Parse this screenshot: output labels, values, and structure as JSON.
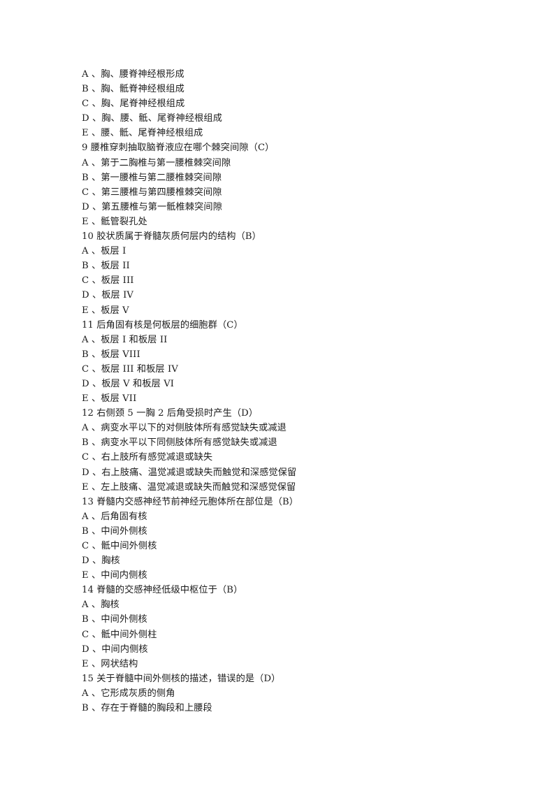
{
  "document": {
    "page_background": "#ffffff",
    "text_color": "#1c1c1c",
    "lines": [
      {
        "id": "l01",
        "kind": "option",
        "text": "A 、胸、腰脊神经根形成"
      },
      {
        "id": "l02",
        "kind": "option",
        "text": "B 、胸、骶脊神经根组成"
      },
      {
        "id": "l03",
        "kind": "option",
        "text": "C 、胸、尾脊神经根组成"
      },
      {
        "id": "l04",
        "kind": "option",
        "text": "D 、胸、腰、骶、尾脊神经根组成"
      },
      {
        "id": "l05",
        "kind": "option",
        "text": "E 、腰、骶、尾脊神经根组成"
      },
      {
        "id": "l06",
        "kind": "stem",
        "text": "9 腰椎穿刺抽取脑脊液应在哪个棘突间隙（C）"
      },
      {
        "id": "l07",
        "kind": "option",
        "text": "A 、第于二胸椎与第一腰椎棘突间隙"
      },
      {
        "id": "l08",
        "kind": "option",
        "text": "B 、第一腰椎与第二腰椎棘突间隙"
      },
      {
        "id": "l09",
        "kind": "option",
        "text": "C 、第三腰椎与第四腰椎棘突间隙"
      },
      {
        "id": "l10",
        "kind": "option",
        "text": "D 、第五腰椎与第一骶椎棘突间隙"
      },
      {
        "id": "l11",
        "kind": "option",
        "text": "E 、骶管裂孔处"
      },
      {
        "id": "l12",
        "kind": "stem",
        "text": "10 胶状质属于脊髓灰质何层内的结构（B）"
      },
      {
        "id": "l13",
        "kind": "option",
        "text": "A 、板层 I"
      },
      {
        "id": "l14",
        "kind": "option",
        "text": "B 、板层 II"
      },
      {
        "id": "l15",
        "kind": "option",
        "text": "C 、板层 III"
      },
      {
        "id": "l16",
        "kind": "option",
        "text": "D 、板层 IV"
      },
      {
        "id": "l17",
        "kind": "option",
        "text": "E 、板层 V"
      },
      {
        "id": "l18",
        "kind": "stem",
        "text": "11 后角固有核是何板层的细胞群（C）"
      },
      {
        "id": "l19",
        "kind": "option",
        "text": "A 、板层 I 和板层 II"
      },
      {
        "id": "l20",
        "kind": "option",
        "text": "B 、板层 VIII"
      },
      {
        "id": "l21",
        "kind": "option",
        "text": "C 、板层 III 和板层 IV"
      },
      {
        "id": "l22",
        "kind": "option",
        "text": "D 、板层 V 和板层 VI"
      },
      {
        "id": "l23",
        "kind": "option",
        "text": "E 、板层 VII"
      },
      {
        "id": "l24",
        "kind": "stem",
        "text": "12 右侧颈 5 一胸 2 后角受损时产生（D）"
      },
      {
        "id": "l25",
        "kind": "option",
        "text": "A 、病变水平以下的对侧肢体所有感觉缺失或减退"
      },
      {
        "id": "l26",
        "kind": "option",
        "text": "B 、病变水平以下同侧肢体所有感觉缺失或减退"
      },
      {
        "id": "l27",
        "kind": "option",
        "text": "C 、右上肢所有感觉减退或缺失"
      },
      {
        "id": "l28",
        "kind": "option",
        "text": "D 、右上肢痛、温觉减退或缺失而触觉和深感觉保留"
      },
      {
        "id": "l29",
        "kind": "option",
        "text": "E 、左上肢痛、温觉减退或缺失而触觉和深感觉保留"
      },
      {
        "id": "l30",
        "kind": "stem",
        "text": "13 脊髓内交感神经节前神经元胞体所在部位是（B）"
      },
      {
        "id": "l31",
        "kind": "option",
        "text": "A 、后角固有核"
      },
      {
        "id": "l32",
        "kind": "option",
        "text": "B 、中间外侧核"
      },
      {
        "id": "l33",
        "kind": "option",
        "text": "C 、骶中间外侧核"
      },
      {
        "id": "l34",
        "kind": "option",
        "text": "D 、胸核"
      },
      {
        "id": "l35",
        "kind": "option",
        "text": "E 、中间内侧核"
      },
      {
        "id": "l36",
        "kind": "stem",
        "text": "14 脊髓的交感神经低级中枢位于（B）"
      },
      {
        "id": "l37",
        "kind": "option",
        "text": "A 、胸核"
      },
      {
        "id": "l38",
        "kind": "option",
        "text": "B 、中间外侧核"
      },
      {
        "id": "l39",
        "kind": "option",
        "text": "C 、骶中间外侧柱"
      },
      {
        "id": "l40",
        "kind": "option",
        "text": "D 、中间内侧核"
      },
      {
        "id": "l41",
        "kind": "option",
        "text": "E 、网状结构"
      },
      {
        "id": "l42",
        "kind": "stem",
        "text": "15 关于脊髓中间外侧核的描述，错误的是（D）"
      },
      {
        "id": "l43",
        "kind": "option",
        "text": "A 、它形成灰质的侧角"
      },
      {
        "id": "l44",
        "kind": "option",
        "text": "B 、存在于脊髓的胸段和上腰段"
      }
    ]
  }
}
